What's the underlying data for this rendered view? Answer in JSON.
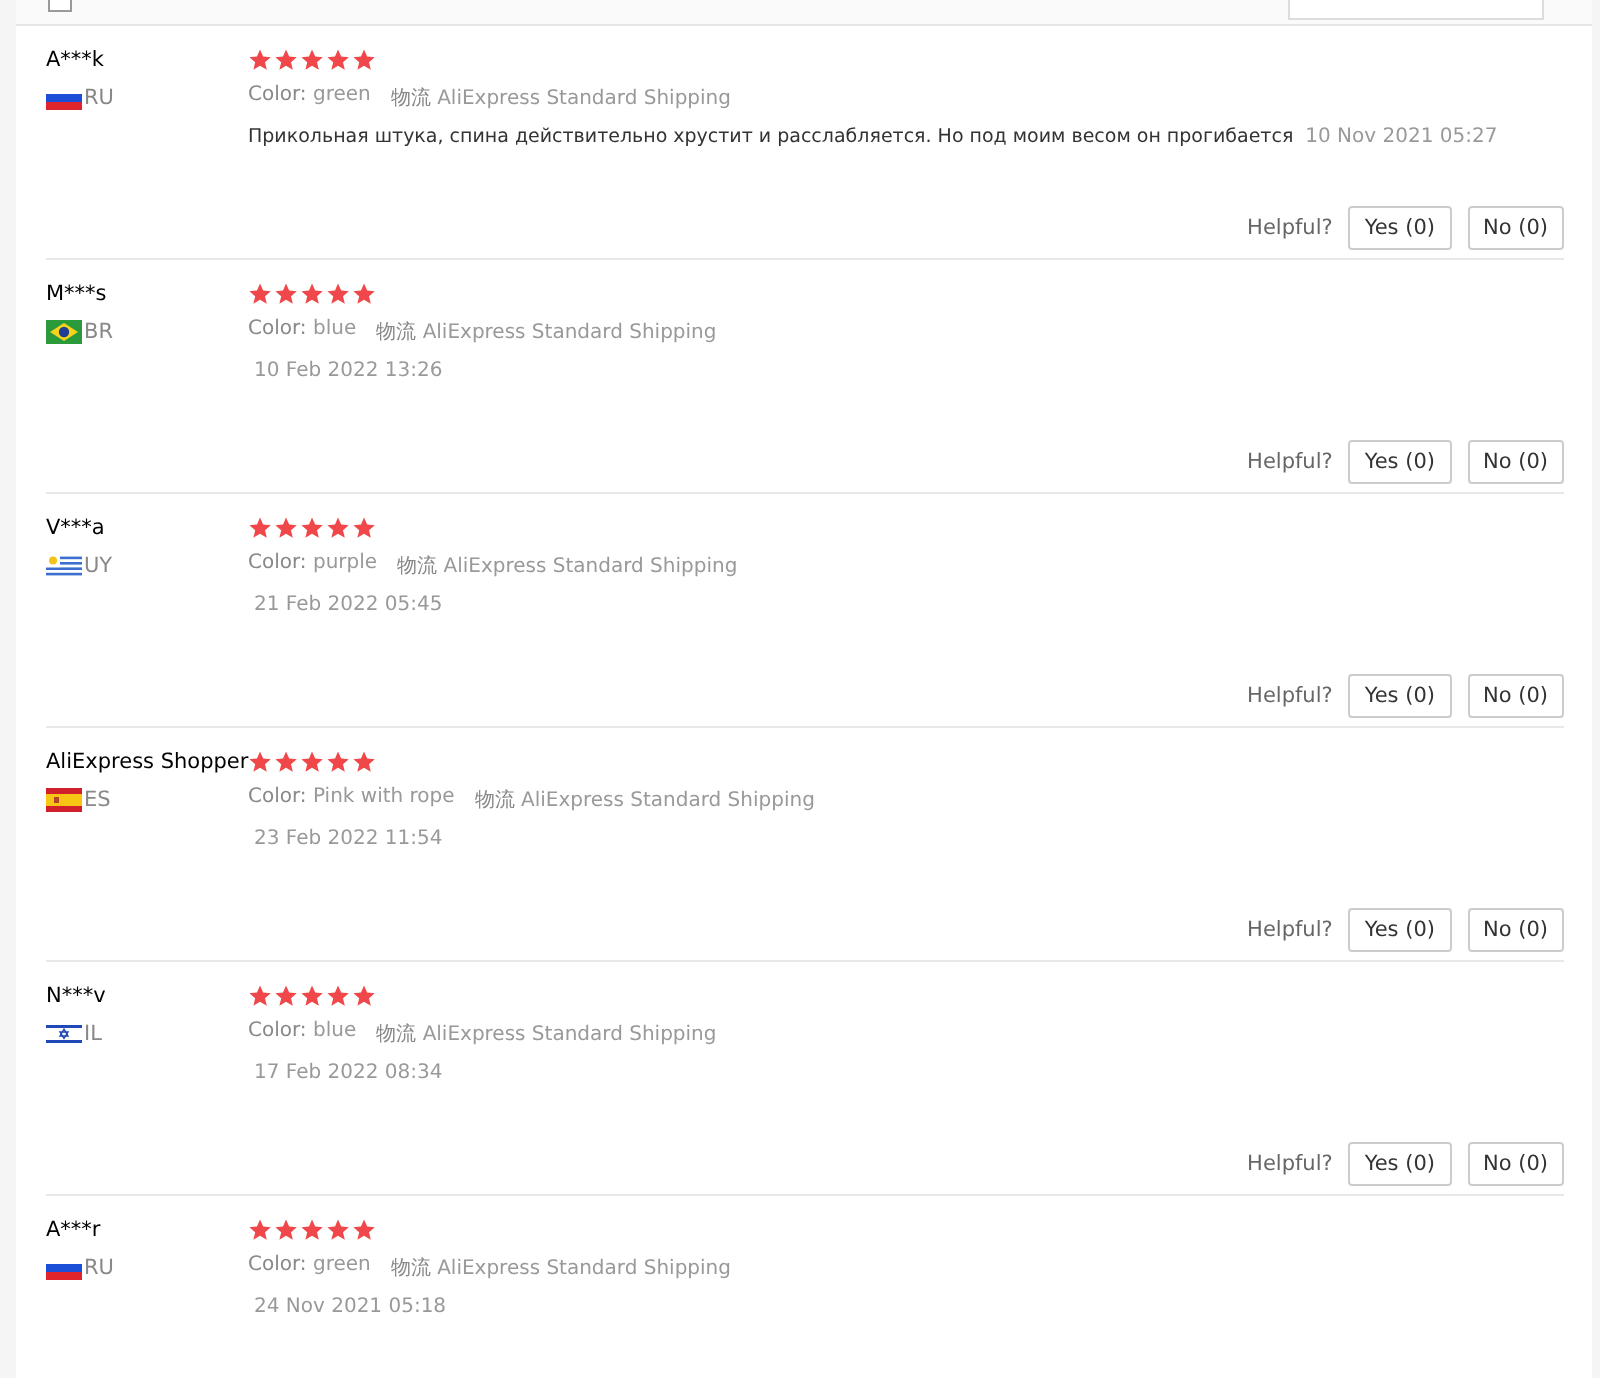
{
  "top_bar": {
    "checkbox": {
      "checked": false
    }
  },
  "reviews": [
    {
      "name": "A***k",
      "kind": "ru",
      "country": "RU",
      "stars": 5,
      "color_label": "Color:",
      "color_value": "green",
      "shipping_label": "物流",
      "shipping": "AliExpress Standard Shipping",
      "text": "Прикольная штука, спина действительно хрустит и расслабляется. Но под моим весом он прогибается",
      "date": "10 Nov 2021 05:27",
      "helpful": "Helpful?",
      "yes": "Yes (0)",
      "no": "No (0)"
    },
    {
      "name": "M***s",
      "kind": "br",
      "country": "BR",
      "stars": 5,
      "color_label": "Color:",
      "color_value": "blue",
      "shipping_label": "物流",
      "shipping": "AliExpress Standard Shipping",
      "date": "10 Feb 2022 13:26",
      "helpful": "Helpful?",
      "yes": "Yes (0)",
      "no": "No (0)"
    },
    {
      "name": "V***a",
      "kind": "uy",
      "country": "UY",
      "stars": 5,
      "color_label": "Color:",
      "color_value": "purple",
      "shipping_label": "物流",
      "shipping": "AliExpress Standard Shipping",
      "date": "21 Feb 2022 05:45",
      "helpful": "Helpful?",
      "yes": "Yes (0)",
      "no": "No (0)"
    },
    {
      "name": "AliExpress Shopper",
      "kind": "es",
      "country": "ES",
      "stars": 5,
      "color_label": "Color:",
      "color_value": "Pink with rope",
      "shipping_label": "物流",
      "shipping": "AliExpress Standard Shipping",
      "date": "23 Feb 2022 11:54",
      "helpful": "Helpful?",
      "yes": "Yes (0)",
      "no": "No (0)"
    },
    {
      "name": "N***v",
      "kind": "il",
      "country": "IL",
      "stars": 5,
      "color_label": "Color:",
      "color_value": "blue",
      "shipping_label": "物流",
      "shipping": "AliExpress Standard Shipping",
      "date": "17 Feb 2022 08:34",
      "helpful": "Helpful?",
      "yes": "Yes (0)",
      "no": "No (0)"
    },
    {
      "name": "A***r",
      "kind": "ru",
      "country": "RU",
      "stars": 5,
      "color_label": "Color:",
      "color_value": "green",
      "shipping_label": "物流",
      "shipping": "AliExpress Standard Shipping",
      "date": "24 Nov 2021 05:18"
    }
  ]
}
